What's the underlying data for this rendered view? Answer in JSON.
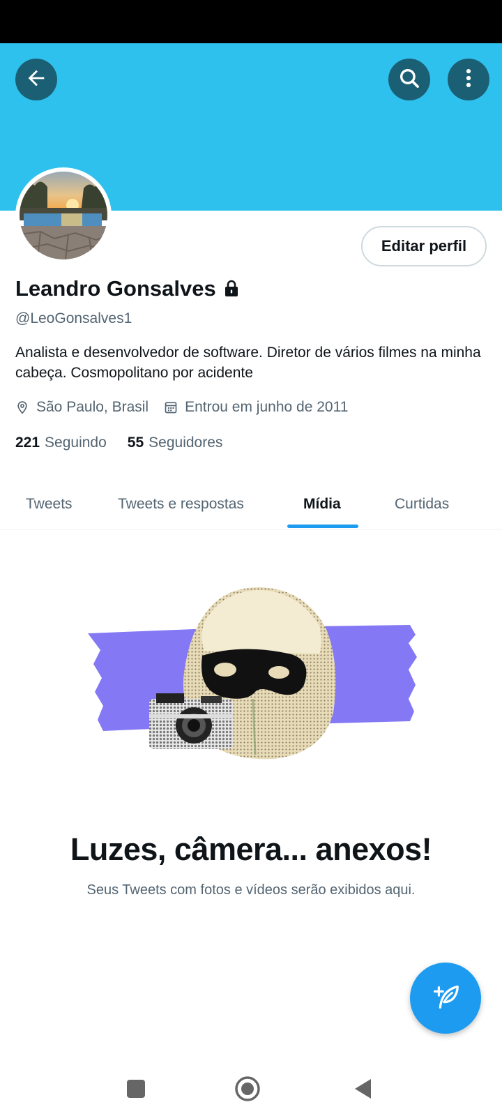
{
  "header": {
    "back_icon": "arrow-left-icon",
    "search_icon": "search-icon",
    "more_icon": "more-vertical-icon",
    "banner_color": "#2fc1ed"
  },
  "profile": {
    "name": "Leandro Gonsalves",
    "protected_icon": "lock-icon",
    "handle": "@LeoGonsalves1",
    "bio": "Analista e desenvolvedor de software. Diretor de vários filmes na minha cabeça. Cosmopolitano por acidente",
    "location": "São Paulo, Brasil",
    "joined": "Entrou em junho de 2011",
    "following_count": "221",
    "following_label": "Seguindo",
    "followers_count": "55",
    "followers_label": "Seguidores",
    "edit_button": "Editar perfil"
  },
  "tabs": [
    {
      "label": "Tweets",
      "active": false
    },
    {
      "label": "Tweets e respostas",
      "active": false
    },
    {
      "label": "Mídia",
      "active": true
    },
    {
      "label": "Curtidas",
      "active": false
    }
  ],
  "empty_state": {
    "title": "Luzes, câmera... anexos!",
    "subtitle": "Seus Tweets com fotos e vídeos serão exibidos aqui."
  },
  "fab": {
    "icon": "compose-tweet-icon",
    "color": "#1d9bf0"
  },
  "nav": {
    "recents_icon": "square-icon",
    "home_icon": "circle-icon",
    "back_icon": "triangle-back-icon"
  }
}
